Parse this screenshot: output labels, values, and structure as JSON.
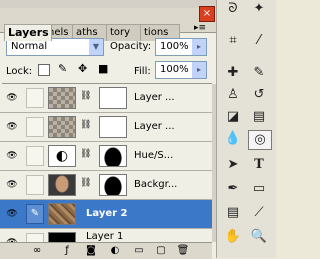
{
  "tabs": [
    {
      "label": "Layers",
      "active": true
    },
    {
      "label": "nels",
      "active": false
    },
    {
      "label": "aths",
      "active": false
    },
    {
      "label": "tory",
      "active": false
    },
    {
      "label": "tions",
      "active": false
    }
  ],
  "close_icon": "×",
  "panel_menu_icon": "▸≡",
  "blend_mode": {
    "value": "Normal"
  },
  "opacity": {
    "label": "Opacity:",
    "value": "100%"
  },
  "lock": {
    "label": "Lock:"
  },
  "fill": {
    "label": "Fill:",
    "value": "100%"
  },
  "lock_icons": [
    "lock-transparency-icon",
    "lock-paint-icon",
    "lock-move-icon",
    "lock-all-icon"
  ],
  "layers": [
    {
      "name": "Layer ...",
      "visible": true,
      "has_link": true,
      "thumb": "checker-dark",
      "has_mask": true,
      "selected": false
    },
    {
      "name": "Layer ...",
      "visible": true,
      "has_link": true,
      "thumb": "checker-dark",
      "has_mask": true,
      "selected": false
    },
    {
      "name": "Hue/S...",
      "visible": true,
      "has_link": true,
      "thumb": "adjustment",
      "has_mask": true,
      "selected": false
    },
    {
      "name": "Backgr...",
      "visible": true,
      "has_link": true,
      "thumb": "photo",
      "has_mask": true,
      "selected": false
    },
    {
      "name": "Layer 2",
      "visible": true,
      "has_link": false,
      "thumb": "texture",
      "has_mask": false,
      "selected": true
    },
    {
      "name": "Layer 1",
      "visible": true,
      "has_link": false,
      "thumb": "black",
      "has_mask": false,
      "selected": false
    }
  ],
  "bottom_icons": [
    "link-layers-icon",
    "layer-style-icon",
    "add-mask-icon",
    "new-adjustment-icon",
    "new-group-icon",
    "new-layer-icon",
    "trash-icon"
  ],
  "tools": [
    "lasso-icon",
    "magic-wand-icon",
    "crop-icon",
    "slice-icon",
    "healing-brush-icon",
    "brush-icon",
    "clone-stamp-icon",
    "history-brush-icon",
    "eraser-icon",
    "gradient-icon",
    "blur-icon",
    "dodge-icon",
    "path-selection-icon",
    "type-icon",
    "pen-icon",
    "shape-icon",
    "notes-icon",
    "eyedropper-icon",
    "hand-icon",
    "zoom-icon"
  ]
}
